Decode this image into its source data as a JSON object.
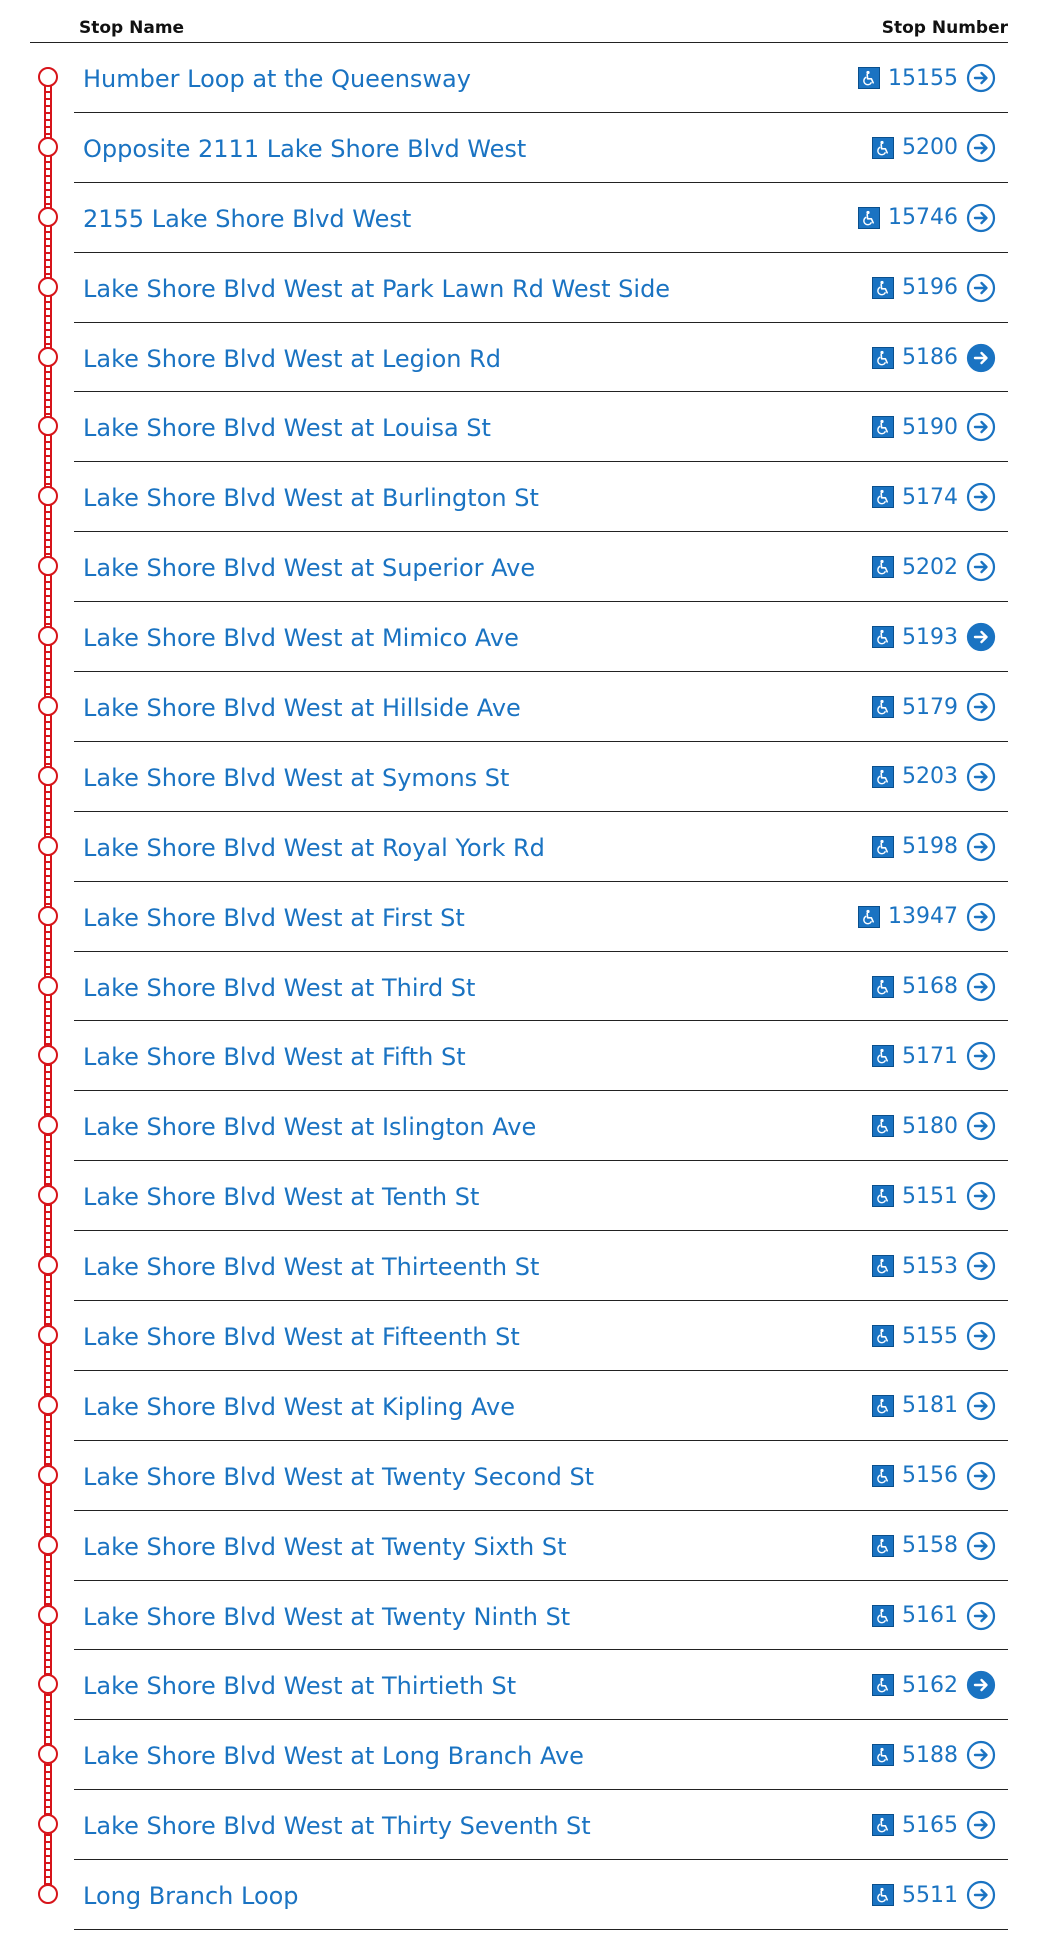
{
  "header": {
    "stop_name_label": "Stop Name",
    "stop_number_label": "Stop Number"
  },
  "colors": {
    "route_line": "#d7141a",
    "link": "#1a73c2",
    "divider": "#222222"
  },
  "icons": {
    "accessible": "wheelchair-icon",
    "go": "arrow-right-circle-icon"
  },
  "stops": [
    {
      "name": "Humber Loop at the Queensway",
      "number": "15155",
      "arrow": "outline"
    },
    {
      "name": "Opposite 2111 Lake Shore Blvd West",
      "number": "5200",
      "arrow": "outline"
    },
    {
      "name": "2155 Lake Shore Blvd West",
      "number": "15746",
      "arrow": "outline"
    },
    {
      "name": "Lake Shore Blvd West at Park Lawn Rd West Side",
      "number": "5196",
      "arrow": "outline"
    },
    {
      "name": "Lake Shore Blvd West at Legion Rd",
      "number": "5186",
      "arrow": "filled"
    },
    {
      "name": "Lake Shore Blvd West at Louisa St",
      "number": "5190",
      "arrow": "outline"
    },
    {
      "name": "Lake Shore Blvd West at Burlington St",
      "number": "5174",
      "arrow": "outline"
    },
    {
      "name": "Lake Shore Blvd West at Superior Ave",
      "number": "5202",
      "arrow": "outline"
    },
    {
      "name": "Lake Shore Blvd West at Mimico Ave",
      "number": "5193",
      "arrow": "filled"
    },
    {
      "name": "Lake Shore Blvd West at Hillside Ave",
      "number": "5179",
      "arrow": "outline"
    },
    {
      "name": "Lake Shore Blvd West at Symons St",
      "number": "5203",
      "arrow": "outline"
    },
    {
      "name": "Lake Shore Blvd West at Royal York Rd",
      "number": "5198",
      "arrow": "outline"
    },
    {
      "name": "Lake Shore Blvd West at First St",
      "number": "13947",
      "arrow": "outline"
    },
    {
      "name": "Lake Shore Blvd West at Third St",
      "number": "5168",
      "arrow": "outline"
    },
    {
      "name": "Lake Shore Blvd West at Fifth St",
      "number": "5171",
      "arrow": "outline"
    },
    {
      "name": "Lake Shore Blvd West at Islington Ave",
      "number": "5180",
      "arrow": "outline"
    },
    {
      "name": "Lake Shore Blvd West at Tenth St",
      "number": "5151",
      "arrow": "outline"
    },
    {
      "name": "Lake Shore Blvd West at Thirteenth St",
      "number": "5153",
      "arrow": "outline"
    },
    {
      "name": "Lake Shore Blvd West at Fifteenth St",
      "number": "5155",
      "arrow": "outline"
    },
    {
      "name": "Lake Shore Blvd West at Kipling Ave",
      "number": "5181",
      "arrow": "outline"
    },
    {
      "name": "Lake Shore Blvd West at Twenty Second St",
      "number": "5156",
      "arrow": "outline"
    },
    {
      "name": "Lake Shore Blvd West at Twenty Sixth St",
      "number": "5158",
      "arrow": "outline"
    },
    {
      "name": "Lake Shore Blvd West at Twenty Ninth St",
      "number": "5161",
      "arrow": "outline"
    },
    {
      "name": "Lake Shore Blvd West at Thirtieth St",
      "number": "5162",
      "arrow": "filled"
    },
    {
      "name": "Lake Shore Blvd West at Long Branch Ave",
      "number": "5188",
      "arrow": "outline"
    },
    {
      "name": "Lake Shore Blvd West at Thirty Seventh St",
      "number": "5165",
      "arrow": "outline"
    },
    {
      "name": "Long Branch Loop",
      "number": "5511",
      "arrow": "outline"
    }
  ]
}
